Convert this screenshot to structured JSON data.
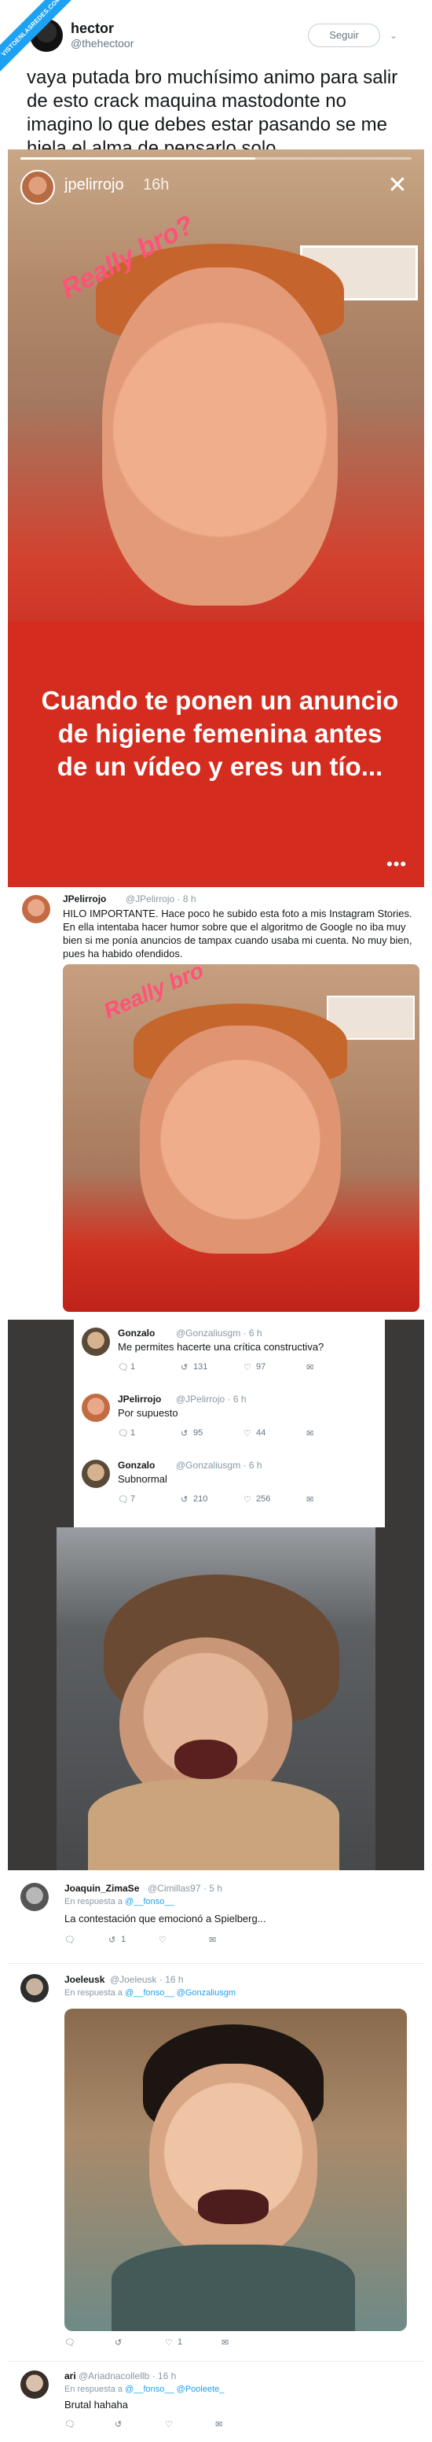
{
  "watermark": "VISTOENLASREDES.COM",
  "top_tweet": {
    "name": "hector",
    "handle": "@thehectoor",
    "follow_label": "Seguir",
    "text": "vaya putada bro muchísimo animo para salir de esto crack maquina mastodonte no imagino lo que debes estar pasando se me hiela el alma de pensarlo solo"
  },
  "story": {
    "username": "jpelirrojo",
    "time": "16h",
    "sticker": "Really bro?",
    "caption": "Cuando te ponen un anuncio de higiene femenina antes de un vídeo y eres un tío...",
    "progress": 0.6
  },
  "thread_tweet": {
    "name": "JPelirrojo",
    "meta": "@JPelirrojo · 8 h",
    "text": "HILO IMPORTANTE. Hace poco he subido esta foto a mis Instagram Stories. En ella intentaba hacer humor sobre que el algoritmo de Google no iba muy bien si me ponía anuncios de tampax cuando usaba mi cuenta. No muy bien, pues ha habido ofendidos.",
    "photo_sticker": "Really bro"
  },
  "conversation": [
    {
      "name": "Gonzalo",
      "meta": "@Gonzaliusgm · 6 h",
      "text": "Me permites hacerte una crítica constructiva?",
      "replies": "1",
      "retweets": "131",
      "likes": "97"
    },
    {
      "name": "JPelirrojo",
      "meta": "@JPelirrojo · 6 h",
      "text": "Por supuesto",
      "replies": "1",
      "retweets": "95",
      "likes": "44"
    },
    {
      "name": "Gonzalo",
      "meta": "@Gonzaliusgm · 6 h",
      "text": "Subnormal",
      "replies": "7",
      "retweets": "210",
      "likes": "256"
    }
  ],
  "replies": [
    {
      "name": "Joaquin_ZimaSe",
      "meta": "@Cimillas97 · 5 h",
      "in_reply_prefix": "En respuesta a",
      "in_reply_to": "@__fonso__",
      "text": "La contestación que emocionó a Spielberg...",
      "replies": "",
      "retweets": "1",
      "likes": ""
    },
    {
      "name": "Joeleusk",
      "meta": "@Joeleusk · 16 h",
      "in_reply_prefix": "En respuesta a",
      "in_reply_to": "@__fonso__ @Gonzaliusgm",
      "text": "",
      "replies": "",
      "retweets": "",
      "likes": "1"
    },
    {
      "name": "ari",
      "meta": "@Ariadnacollellb · 16 h",
      "in_reply_prefix": "En respuesta a",
      "in_reply_to": "@__fonso__ @Pooleete_",
      "text": "Brutal hahaha",
      "replies": "",
      "retweets": "",
      "likes": ""
    }
  ],
  "colors": {
    "link": "#1da1f2",
    "muted": "#657786",
    "story_red": "#d42c1f",
    "sticker_pink": "#ff5277"
  },
  "icons": {
    "reply": "reply-icon",
    "retweet": "retweet-icon",
    "like": "heart-icon",
    "dm": "envelope-icon",
    "close": "close-icon"
  }
}
